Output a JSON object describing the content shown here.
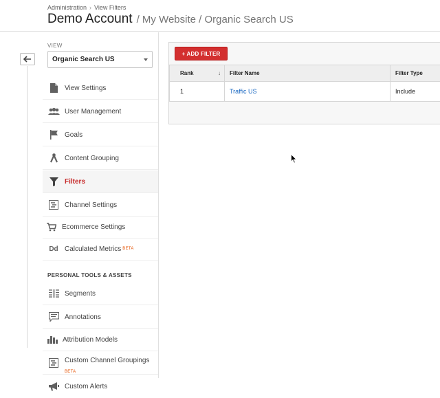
{
  "breadcrumb": {
    "items": [
      "Administration",
      "View Filters"
    ],
    "separator": "›"
  },
  "header": {
    "account": "Demo Account",
    "path": "/ My Website / Organic Search US"
  },
  "view": {
    "label": "VIEW",
    "selected": "Organic Search US"
  },
  "nav": {
    "items": [
      {
        "label": "View Settings",
        "icon": "document-icon"
      },
      {
        "label": "User Management",
        "icon": "users-icon"
      },
      {
        "label": "Goals",
        "icon": "flag-icon"
      },
      {
        "label": "Content Grouping",
        "icon": "hierarchy-icon"
      },
      {
        "label": "Filters",
        "icon": "filter-icon",
        "active": true
      },
      {
        "label": "Channel Settings",
        "icon": "channel-icon"
      },
      {
        "label": "Ecommerce Settings",
        "icon": "cart-icon"
      },
      {
        "label": "Calculated Metrics",
        "icon": "calculated-metrics-icon",
        "badge": "BETA"
      }
    ],
    "section_label": "PERSONAL TOOLS & ASSETS",
    "personal_items": [
      {
        "label": "Segments",
        "icon": "segments-icon"
      },
      {
        "label": "Annotations",
        "icon": "annotation-icon"
      },
      {
        "label": "Attribution Models",
        "icon": "bar-chart-icon"
      },
      {
        "label": "Custom Channel Groupings",
        "icon": "channel-grouping-icon",
        "badge": "BETA"
      },
      {
        "label": "Custom Alerts",
        "icon": "megaphone-icon"
      }
    ]
  },
  "filters": {
    "add_label": "+ ADD FILTER",
    "columns": [
      "Rank",
      "Filter Name",
      "Filter Type"
    ],
    "rows": [
      {
        "rank": "1",
        "name": "Traffic US",
        "type": "Include"
      }
    ]
  },
  "colors": {
    "accent": "#d32f2f",
    "active_text": "#c62828",
    "link": "#1565c0",
    "beta": "#e65100"
  }
}
